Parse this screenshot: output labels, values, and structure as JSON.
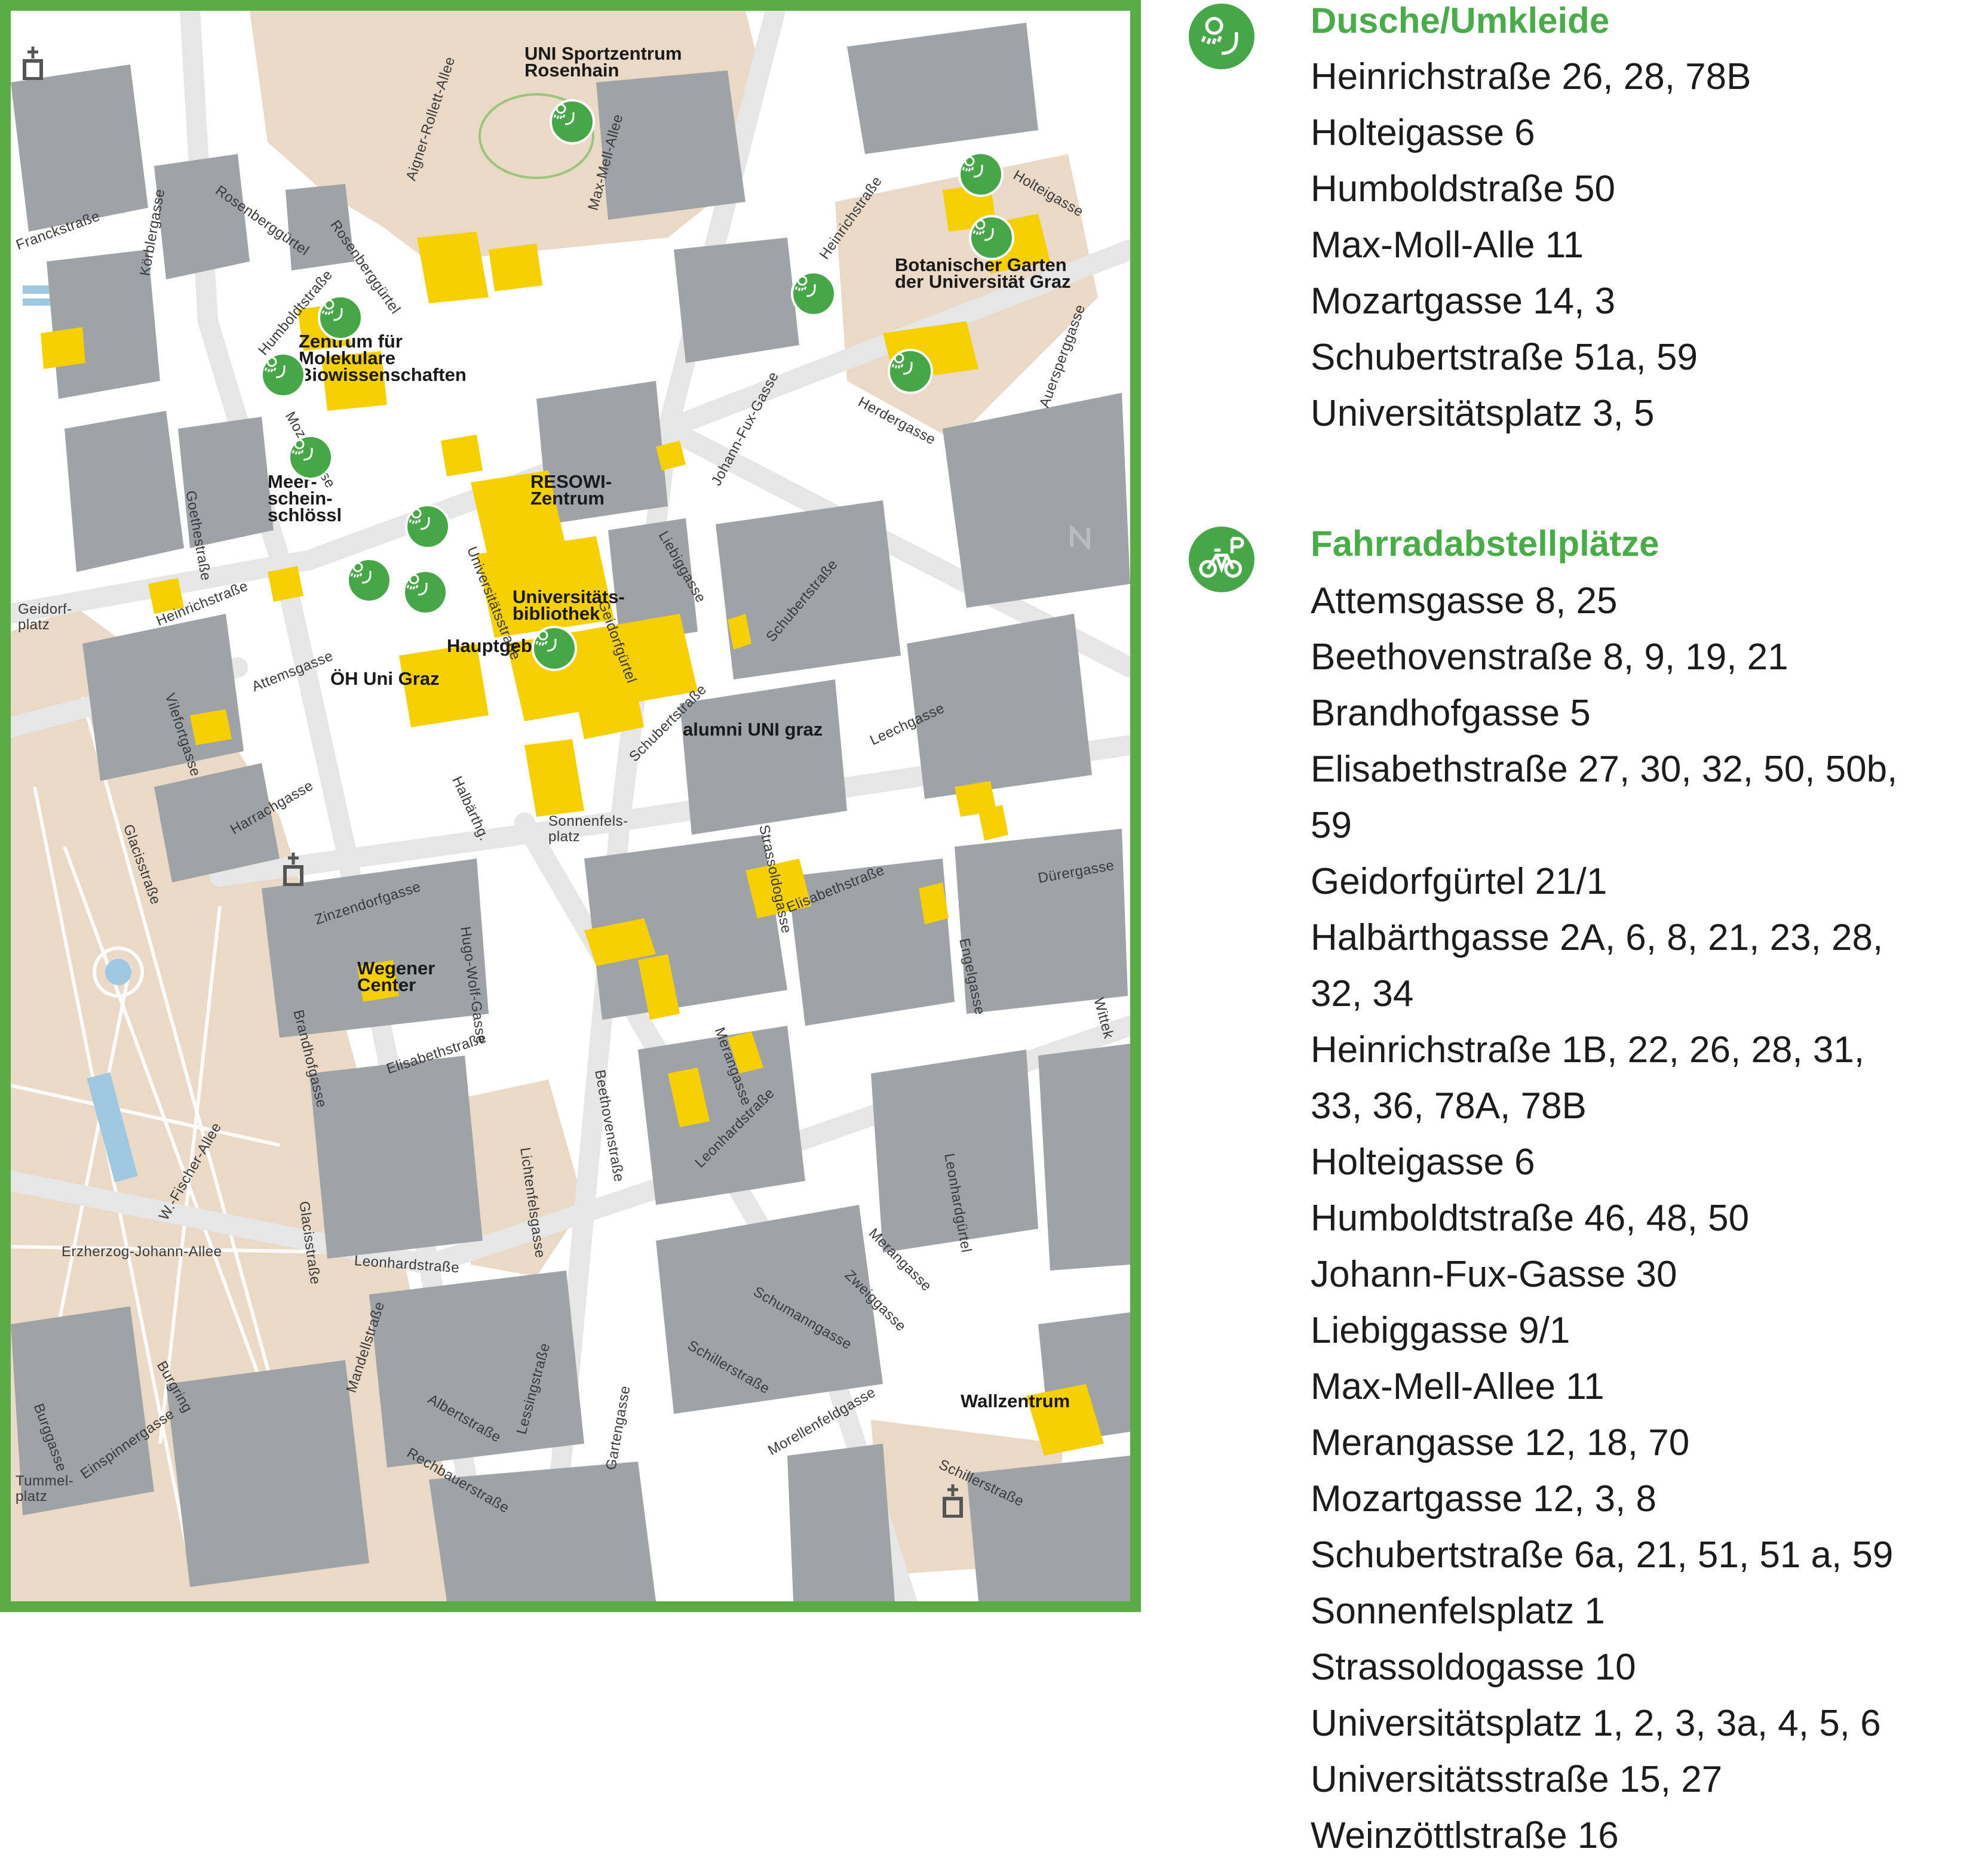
{
  "colors": {
    "frame": "#5aaa46",
    "building": "#9fa3a6",
    "university_building": "#f6cf00",
    "park": "#ead9c6",
    "water": "#9ec8e0",
    "icon_green": "#47a648",
    "legend_title": "#4aab49"
  },
  "map": {
    "streets": [
      "Franckstraße",
      "Körblergasse",
      "Rosenberggürtel",
      "Rosenberggürtel",
      "Aigner-Rollett-Allee",
      "Max-Mell-Allee",
      "Heinrichstraße",
      "Holteigasse",
      "Humboldtstraße",
      "Mozartgasse",
      "Goethestraße",
      "Universitätsstraße",
      "Liebiggasse",
      "Johann-Fux-Gasse",
      "Herdergasse",
      "Auersperggasse",
      "Geidorfgürtel",
      "Schubertstraße",
      "Heinrichstraße",
      "Vilefortgasse",
      "Attemsgasse",
      "Schubertstraße",
      "Leechgasse",
      "Halbärthg.",
      "Harrachgasse",
      "Glacisstraße",
      "Strassoldogasse",
      "Zinzendorfgasse",
      "Hugo-Wolf-Gasse",
      "Elisabethstraße",
      "Dürergasse",
      "Engelgasse",
      "Brandhofgasse",
      "Elisabethstraße",
      "Merangasse",
      "Beethovenstraße",
      "Lichtenfelsgasse",
      "Leonhardstraße",
      "Leonhardgürtel",
      "Merangasse",
      "W.-Fischer-Allee",
      "Glacisstraße",
      "Erzherzog-Johann-Allee",
      "Leonhardstraße",
      "Schumanngasse",
      "Zweiggasse",
      "Mandellstraße",
      "Burgring",
      "Schillerstraße",
      "Albertstraße",
      "Lessingstraße",
      "Gartengasse",
      "Morellenfeldgasse",
      "Rechbauerstraße",
      "Einspinnergasse",
      "Burggasse",
      "Schillerstraße",
      "Wittek"
    ],
    "places": [
      "Geidorf-\nplatz",
      "Sonnenfels-\nplatz",
      "Tummel-\nplatz"
    ],
    "pois": [
      "UNI Sportzentrum\nRosenhain",
      "Botanischer Garten\nder Universität Graz",
      "Zentrum für\nMolekulare\nBiowissenschaften",
      "Meer-\nschein-\nschlössl",
      "RESOWI-\nZentrum",
      "Universitäts-\nbibliothek",
      "Hauptgebäude",
      "ÖH Uni Graz",
      "alumni UNI graz",
      "Wegener\nCenter",
      "Wallzentrum"
    ],
    "markers": [
      "shower-icon",
      "church-icon",
      "north-arrow-icon"
    ]
  },
  "legend": {
    "showers": {
      "icon": "shower-icon",
      "title": "Dusche/Umkleide",
      "items": [
        "Heinrichstraße 26, 28, 78B",
        "Holteigasse 6",
        "Humboldstraße 50",
        "Max-Moll-Alle 11",
        "Mozartgasse 14, 3",
        "Schubertstraße 51a, 59",
        "Universitätsplatz 3, 5"
      ]
    },
    "bikes": {
      "icon": "bike-parking-icon",
      "title": "Fahrradabstellplätze",
      "items": [
        "Attemsgasse 8, 25",
        "Beethovenstraße 8, 9, 19, 21",
        "Brandhofgasse 5",
        "Elisabethstraße 27, 30, 32, 50, 50b,",
        "59",
        "Geidorfgürtel 21/1",
        "Halbärthgasse 2A, 6, 8, 21, 23, 28,",
        "32, 34",
        "Heinrichstraße 1B, 22, 26, 28, 31,",
        "33, 36, 78A, 78B",
        "Holteigasse 6",
        "Humboldtstraße 46, 48, 50",
        "Johann-Fux-Gasse 30",
        "Liebiggasse 9/1",
        "Max-Mell-Allee 11",
        "Merangasse 12, 18, 70",
        "Mozartgasse 12, 3, 8",
        "Schubertstraße 6a, 21, 51, 51 a, 59",
        "Sonnenfelsplatz 1",
        "Strassoldogasse 10",
        "Universitätsplatz 1, 2, 3, 3a, 4, 5, 6",
        "Universitätsstraße 15, 27",
        "Weinzöttlstraße 16"
      ]
    }
  }
}
